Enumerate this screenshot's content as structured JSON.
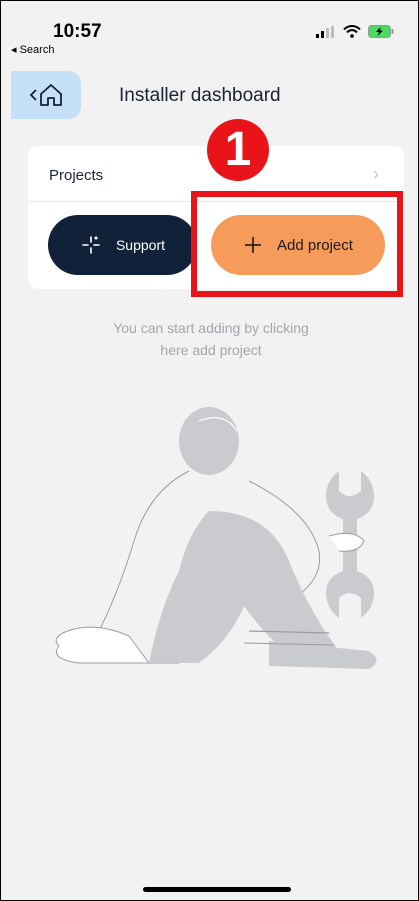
{
  "status_bar": {
    "time": "10:57",
    "back_label": "◂ Search"
  },
  "header": {
    "title": "Installer dashboard"
  },
  "projects_card": {
    "label": "Projects"
  },
  "actions": {
    "support_label": "Support",
    "add_project_label": "Add project"
  },
  "annotation": {
    "step_number": "1"
  },
  "empty_state": {
    "line1": "You can start adding by clicking",
    "line2": "here add project"
  },
  "colors": {
    "accent_orange": "#f79b5b",
    "navy": "#12213a",
    "highlight_red": "#e8141a",
    "home_button_bg": "#c5e0f7"
  },
  "icons": [
    "chevron-left-icon",
    "home-icon",
    "chevron-right-icon",
    "sparkle-icon",
    "plus-icon",
    "signal-icon",
    "wifi-icon",
    "battery-icon"
  ]
}
